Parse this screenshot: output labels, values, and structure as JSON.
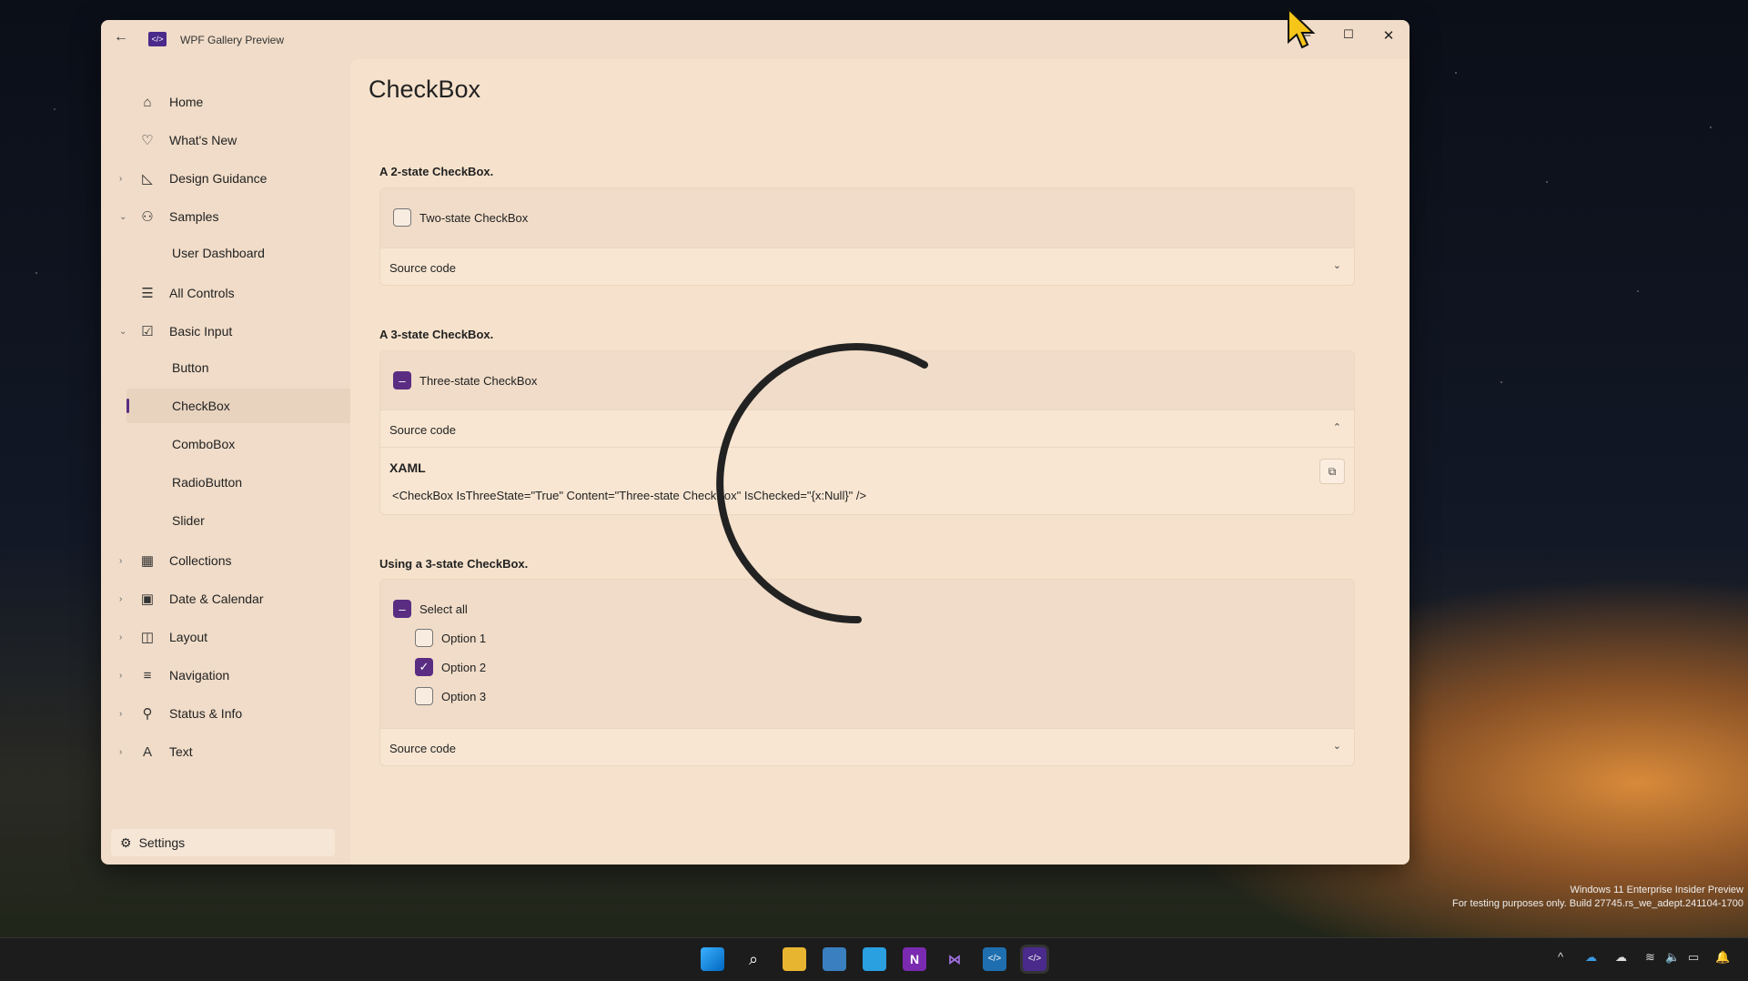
{
  "window": {
    "title": "WPF Gallery Preview",
    "logo_text": "</>"
  },
  "sidebar": {
    "items": [
      {
        "label": "Home",
        "icon": "home-icon",
        "glyph": "⌂"
      },
      {
        "label": "What's New",
        "icon": "heart-icon",
        "glyph": "♡"
      },
      {
        "label": "Design Guidance",
        "icon": "design-icon",
        "glyph": "◺",
        "chevron": "›"
      },
      {
        "label": "Samples",
        "icon": "samples-icon",
        "glyph": "⚇",
        "chevron": "⌄"
      },
      {
        "label": "User Dashboard"
      },
      {
        "label": "All Controls",
        "icon": "list-icon",
        "glyph": "☰"
      },
      {
        "label": "Basic Input",
        "icon": "checkbox-icon",
        "glyph": "☑",
        "chevron": "⌄"
      },
      {
        "label": "Button"
      },
      {
        "label": "CheckBox",
        "selected": true
      },
      {
        "label": "ComboBox"
      },
      {
        "label": "RadioButton"
      },
      {
        "label": "Slider"
      },
      {
        "label": "Collections",
        "icon": "grid-icon",
        "glyph": "▦",
        "chevron": "›"
      },
      {
        "label": "Date & Calendar",
        "icon": "calendar-icon",
        "glyph": "▣",
        "chevron": "›"
      },
      {
        "label": "Layout",
        "icon": "layout-icon",
        "glyph": "◫",
        "chevron": "›"
      },
      {
        "label": "Navigation",
        "icon": "navigation-icon",
        "glyph": "≡",
        "chevron": "›"
      },
      {
        "label": "Status & Info",
        "icon": "status-icon",
        "glyph": "⚲",
        "chevron": "›"
      },
      {
        "label": "Text",
        "icon": "text-icon",
        "glyph": "A",
        "chevron": "›"
      }
    ],
    "settings_label": "Settings"
  },
  "page": {
    "title": "CheckBox",
    "section1": {
      "label": "A 2-state CheckBox.",
      "checkbox": "Two-state CheckBox",
      "source": "Source code"
    },
    "section2": {
      "label": "A 3-state CheckBox.",
      "checkbox": "Three-state CheckBox",
      "source": "Source code",
      "xaml_title": "XAML",
      "xaml_code": "<CheckBox IsThreeState=\"True\" Content=\"Three-state CheckBox\" IsChecked=\"{x:Null}\" />"
    },
    "section3": {
      "label": "Using a 3-state CheckBox.",
      "select_all": "Select all",
      "options": [
        {
          "label": "Option 1",
          "checked": false
        },
        {
          "label": "Option 2",
          "checked": true
        },
        {
          "label": "Option 3",
          "checked": false
        }
      ],
      "source": "Source code"
    }
  },
  "watermark": {
    "line1": "Windows 11 Enterprise Insider Preview",
    "line2": "For testing purposes only. Build 27745.rs_we_adept.241104-1700"
  },
  "colors": {
    "accent": "#5a2d82",
    "window_bg": "#f0dcc8",
    "content_bg": "#f6e2cc"
  }
}
